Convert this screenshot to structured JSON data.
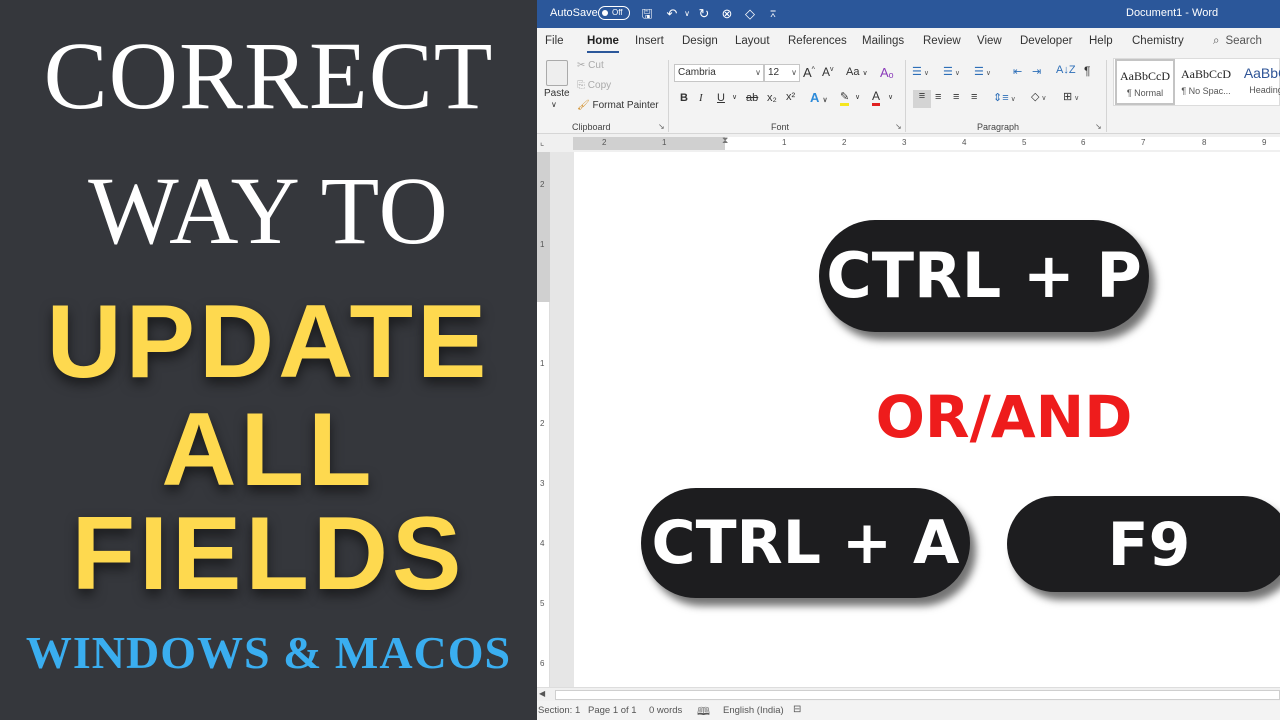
{
  "promo": {
    "line1": "CORRECT",
    "line2": "WAY TO",
    "line3": "UPDATE",
    "line4": "ALL",
    "line5": "FIELDS",
    "platforms": "WINDOWS & MACOS",
    "colors": {
      "background": "#35373c",
      "title_white": "#ffffff",
      "highlight_yellow": "#fed94f",
      "platform_blue": "#3aaef0"
    }
  },
  "word": {
    "titlebar": {
      "autosave_label": "AutoSave",
      "autosave_state": "Off",
      "document_title": "Document1  -  Word",
      "quick_access_icons": [
        "save-icon",
        "undo-icon",
        "undo-dropdown-icon",
        "redo-icon",
        "cancel-icon",
        "eraser-icon",
        "customize-qat-icon"
      ]
    },
    "tabs": [
      {
        "label": "File",
        "active": false
      },
      {
        "label": "Home",
        "active": true
      },
      {
        "label": "Insert",
        "active": false
      },
      {
        "label": "Design",
        "active": false
      },
      {
        "label": "Layout",
        "active": false
      },
      {
        "label": "References",
        "active": false
      },
      {
        "label": "Mailings",
        "active": false
      },
      {
        "label": "Review",
        "active": false
      },
      {
        "label": "View",
        "active": false
      },
      {
        "label": "Developer",
        "active": false
      },
      {
        "label": "Help",
        "active": false
      },
      {
        "label": "Chemistry",
        "active": false
      }
    ],
    "search_label": "Search",
    "ribbon": {
      "clipboard": {
        "group_label": "Clipboard",
        "paste": "Paste",
        "cut": "Cut",
        "copy": "Copy",
        "format_painter": "Format Painter"
      },
      "font": {
        "group_label": "Font",
        "font_name": "Cambria",
        "font_size": "12",
        "grow": "A",
        "shrink": "A",
        "change_case": "Aa",
        "bold": "B",
        "italic": "I",
        "underline": "U",
        "strikethrough": "ab",
        "subscript": "x₂",
        "superscript": "x²",
        "text_effects": "A",
        "font_color": "A",
        "highlight_color": "#f5e61e",
        "font_color_value": "#e02020"
      },
      "paragraph": {
        "group_label": "Paragraph",
        "sort": "A↓Z",
        "show_marks": "¶"
      },
      "styles": [
        {
          "sample": "AaBbCcD",
          "name": "¶ Normal",
          "selected": true
        },
        {
          "sample": "AaBbCcD",
          "name": "¶ No Spac...",
          "selected": false
        },
        {
          "sample": "AaBbC",
          "name": "Heading",
          "selected": false
        }
      ]
    },
    "ruler": {
      "horizontal_numbers": [
        "2",
        "1",
        "1",
        "2",
        "3",
        "4",
        "5",
        "6",
        "7",
        "8",
        "9"
      ],
      "vertical_numbers": [
        "2",
        "1",
        "1",
        "2",
        "3",
        "4",
        "5",
        "6"
      ]
    },
    "document": {
      "key1": "CTRL + P",
      "connector": "OR/AND",
      "key2": "CTRL + A",
      "key3": "F9",
      "colors": {
        "key_bg": "#1d1d1f",
        "key_text": "#ffffff",
        "connector": "#ee1c1c"
      }
    },
    "statusbar": {
      "section": "Section: 1",
      "page": "Page 1 of 1",
      "words": "0 words",
      "language": "English (India)"
    },
    "accent": "#2b579a"
  }
}
